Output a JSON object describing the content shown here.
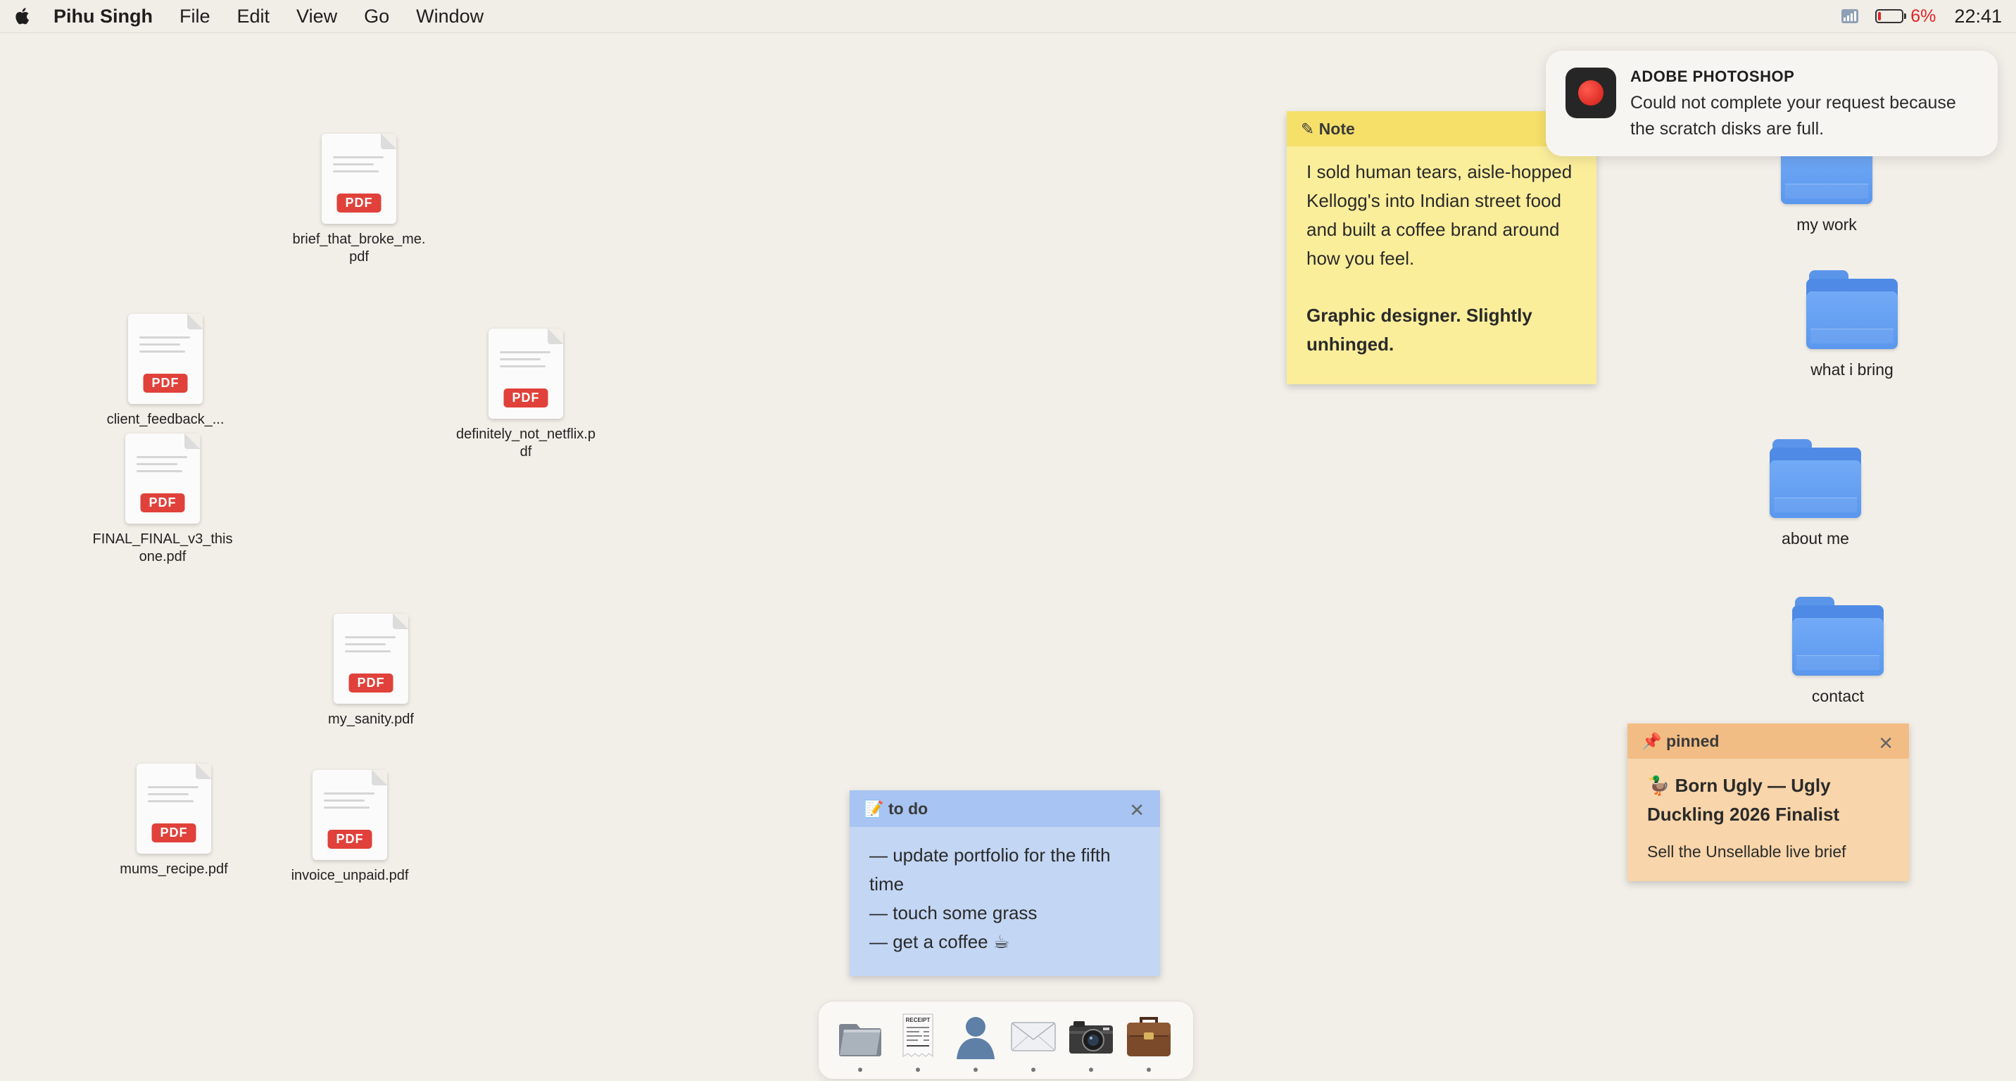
{
  "menubar": {
    "app_name": "Pihu Singh",
    "menus": [
      "File",
      "Edit",
      "View",
      "Go",
      "Window"
    ],
    "battery_percent": "6%",
    "time": "22:41"
  },
  "desktop_files": [
    {
      "name": "brief_that_broke_me.pdf",
      "badge": "PDF"
    },
    {
      "name": "client_feedback_...",
      "badge": "PDF"
    },
    {
      "name": "definitely_not_netflix.pdf",
      "badge": "PDF"
    },
    {
      "name": "FINAL_FINAL_v3_thisone.pdf",
      "badge": "PDF"
    },
    {
      "name": "my_sanity.pdf",
      "badge": "PDF"
    },
    {
      "name": "mums_recipe.pdf",
      "badge": "PDF"
    },
    {
      "name": "invoice_unpaid.pdf",
      "badge": "PDF"
    }
  ],
  "folders": [
    {
      "name": "my work"
    },
    {
      "name": "what i bring"
    },
    {
      "name": "about me"
    },
    {
      "name": "contact"
    }
  ],
  "note_main": {
    "title": "✎ Note",
    "body": "I sold human tears, aisle-hopped Kellogg's into Indian street food and built a coffee brand around how you feel.",
    "tagline": "Graphic designer. Slightly unhinged."
  },
  "note_todo": {
    "title": "📝 to do",
    "items": [
      "— update portfolio for the fifth time",
      "— touch some grass",
      "— get a coffee ☕"
    ],
    "close": "✕"
  },
  "note_pinned": {
    "title": "📌 pinned",
    "headline": "🦆 Born Ugly — Ugly Duckling 2026 Finalist",
    "sub": "Sell the Unsellable live brief",
    "close": "✕"
  },
  "notification": {
    "app": "ADOBE PHOTOSHOP",
    "message": "Could not complete your request because the scratch disks are full.",
    "icon_color": "#e0261c"
  },
  "dock": {
    "items": [
      "finder-icon",
      "receipt-icon",
      "contacts-icon",
      "mail-icon",
      "camera-icon",
      "briefcase-icon"
    ],
    "receipt_label": "RECEIPT"
  }
}
